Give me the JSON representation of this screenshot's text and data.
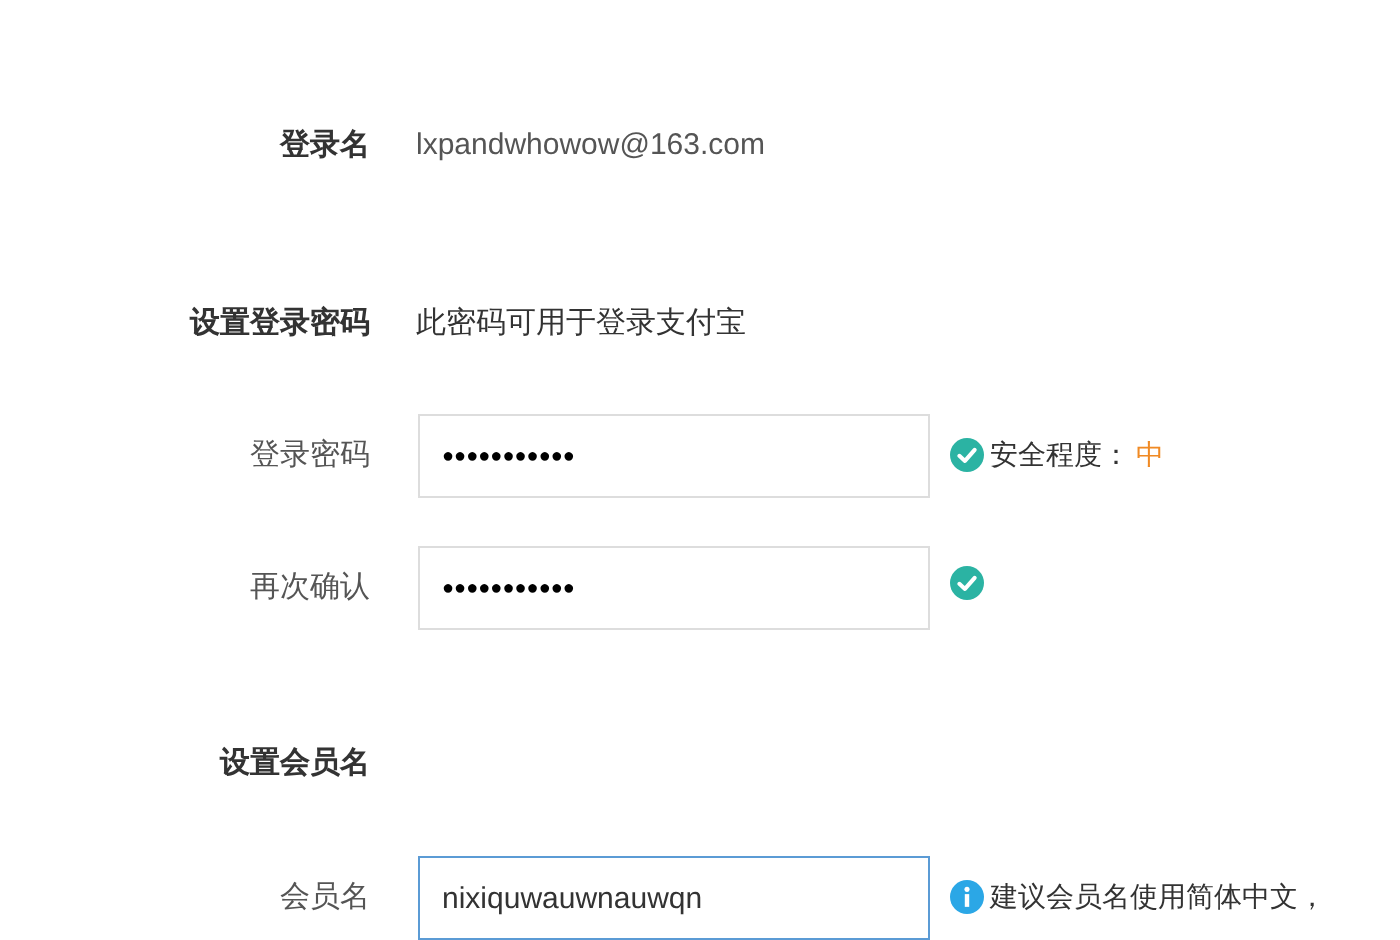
{
  "login_name": {
    "label": "登录名",
    "value": "lxpandwhowow@163.com"
  },
  "password_section": {
    "title": "设置登录密码",
    "note": "此密码可用于登录支付宝"
  },
  "password_fields": [
    {
      "label": "登录密码",
      "value": "●●●●●●●●●●●",
      "valid": true,
      "strength_label": "安全程度：",
      "strength": "中"
    },
    {
      "label": "再次确认",
      "value": "●●●●●●●●●●●",
      "valid": true
    }
  ],
  "member_section": {
    "title": "设置会员名"
  },
  "member_field": {
    "label": "会员名",
    "value": "nixiquwauwnauwqn",
    "focused": true,
    "hint": "建议会员名使用简体中文，"
  }
}
